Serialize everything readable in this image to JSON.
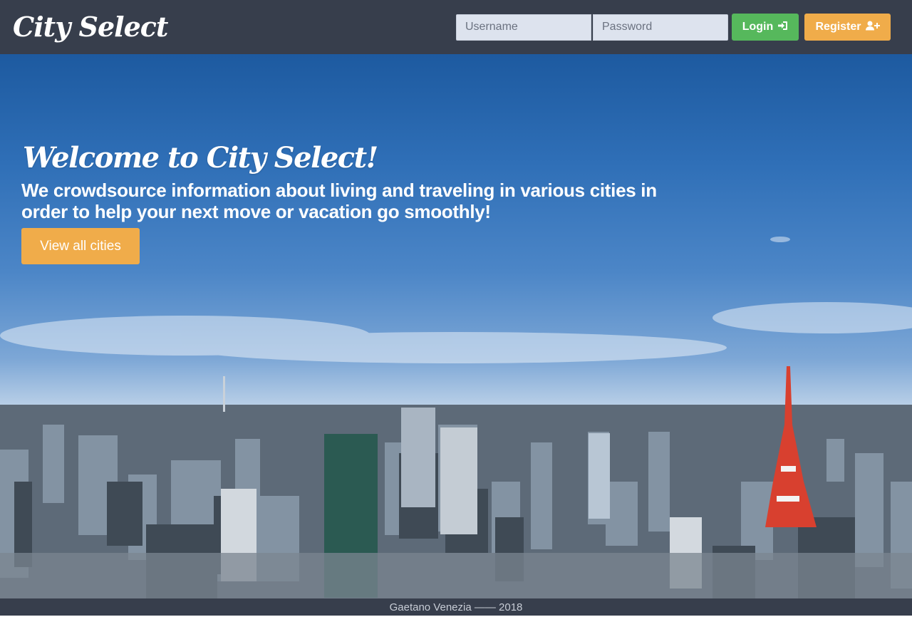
{
  "navbar": {
    "brand": "City Select",
    "username_placeholder": "Username",
    "password_placeholder": "Password",
    "login_label": "Login",
    "register_label": "Register"
  },
  "hero": {
    "title": "Welcome to City Select!",
    "subtitle": "We crowdsource information about living and traveling in various cities in order to help your next move or vacation go smoothly!",
    "cta_label": "View all cities",
    "background_icon": "city-skyline-photo"
  },
  "footer": {
    "text": "Gaetano Venezia —— 2018"
  },
  "colors": {
    "nav_bg": "#373e4c",
    "login_green": "#56b85c",
    "register_orange": "#f0ac4a",
    "field_bg": "#dde3ee"
  }
}
